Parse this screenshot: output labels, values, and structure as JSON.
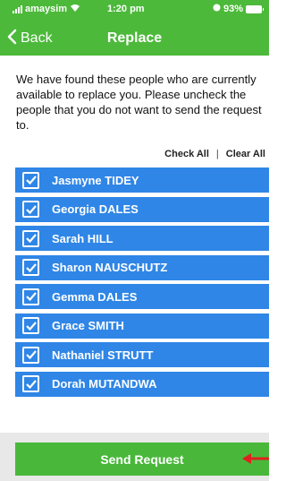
{
  "status_bar": {
    "carrier": "amaysim",
    "time": "1:20 pm",
    "battery": "93%"
  },
  "nav": {
    "back_label": "Back",
    "title": "Replace"
  },
  "intro_text": "We have found these people who are currently available to replace you. Please uncheck the people that you do not want to send the request to.",
  "actions": {
    "check_all": "Check All",
    "separator": "|",
    "clear_all": "Clear All"
  },
  "people": [
    {
      "name": "Jasmyne TIDEY",
      "checked": true
    },
    {
      "name": "Georgia DALES",
      "checked": true
    },
    {
      "name": "Sarah HILL",
      "checked": true
    },
    {
      "name": "Sharon NAUSCHUTZ",
      "checked": true
    },
    {
      "name": "Gemma DALES",
      "checked": true
    },
    {
      "name": "Grace SMITH",
      "checked": true
    },
    {
      "name": "Nathaniel STRUTT",
      "checked": true
    },
    {
      "name": "Dorah MUTANDWA",
      "checked": true
    }
  ],
  "send_button": "Send Request",
  "colors": {
    "header": "#4cb93a",
    "row": "#2f86e6",
    "send": "#49b83a",
    "annotation_arrow": "#e0201e"
  }
}
